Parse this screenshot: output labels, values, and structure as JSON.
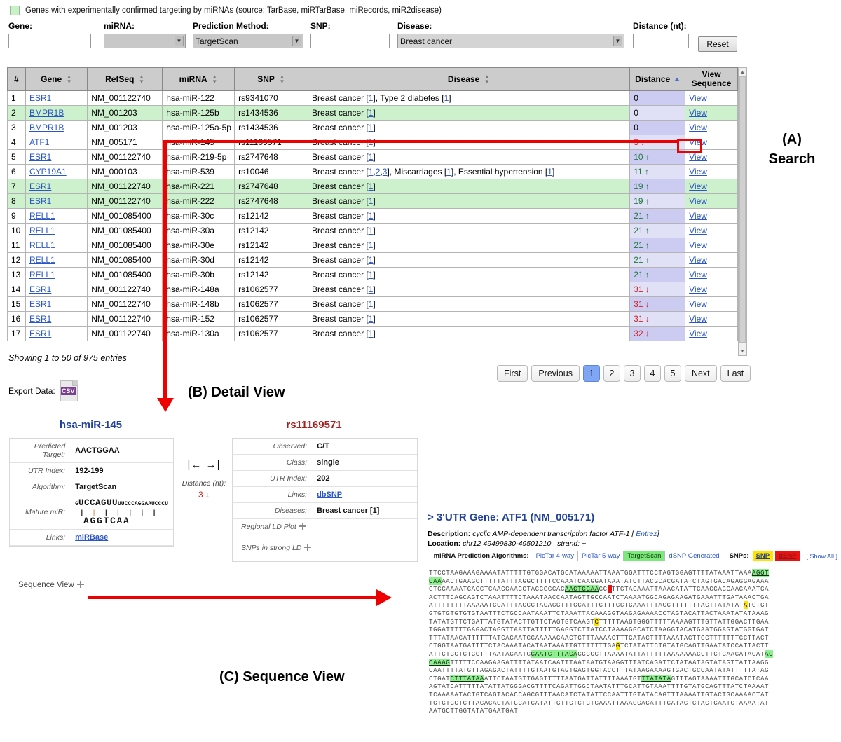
{
  "legend": {
    "text": "Genes with experimentally confirmed targeting by miRNAs (source: TarBase, miRTarBase, miRecords, miR2disease)"
  },
  "search": {
    "gene": {
      "label": "Gene:",
      "value": ""
    },
    "mirna": {
      "label": "miRNA:",
      "value": ""
    },
    "prediction_method": {
      "label": "Prediction Method:",
      "value": "TargetScan"
    },
    "snp": {
      "label": "SNP:",
      "value": ""
    },
    "disease": {
      "label": "Disease:",
      "value": "Breast cancer"
    },
    "distance": {
      "label": "Distance (nt):",
      "value": ""
    },
    "reset_label": "Reset"
  },
  "table": {
    "headers": [
      "#",
      "Gene",
      "RefSeq",
      "miRNA",
      "SNP",
      "Disease",
      "Distance",
      "View Sequence"
    ],
    "view_label": "View",
    "rows": [
      {
        "n": "1",
        "gene": "ESR1",
        "refseq": "NM_001122740",
        "mirna": "hsa-miR-122",
        "snp": "rs9341070",
        "disease": "Breast cancer [1], Type 2 diabetes [1]",
        "distance": "0",
        "dir": "",
        "green": false
      },
      {
        "n": "2",
        "gene": "BMPR1B",
        "refseq": "NM_001203",
        "mirna": "hsa-miR-125b",
        "snp": "rs1434536",
        "disease": "Breast cancer [1]",
        "distance": "0",
        "dir": "",
        "green": true
      },
      {
        "n": "3",
        "gene": "BMPR1B",
        "refseq": "NM_001203",
        "mirna": "hsa-miR-125a-5p",
        "snp": "rs1434536",
        "disease": "Breast cancer [1]",
        "distance": "0",
        "dir": "",
        "green": false
      },
      {
        "n": "4",
        "gene": "ATF1",
        "refseq": "NM_005171",
        "mirna": "hsa-miR-145",
        "snp": "rs11169571",
        "disease": "Breast cancer [1]",
        "distance": "3",
        "dir": "down",
        "green": false
      },
      {
        "n": "5",
        "gene": "ESR1",
        "refseq": "NM_001122740",
        "mirna": "hsa-miR-219-5p",
        "snp": "rs2747648",
        "disease": "Breast cancer [1]",
        "distance": "10",
        "dir": "up",
        "green": false
      },
      {
        "n": "6",
        "gene": "CYP19A1",
        "refseq": "NM_000103",
        "mirna": "hsa-miR-539",
        "snp": "rs10046",
        "disease": "Breast cancer [1,2,3], Miscarriages [1], Essential hypertension [1]",
        "distance": "11",
        "dir": "up",
        "green": false
      },
      {
        "n": "7",
        "gene": "ESR1",
        "refseq": "NM_001122740",
        "mirna": "hsa-miR-221",
        "snp": "rs2747648",
        "disease": "Breast cancer [1]",
        "distance": "19",
        "dir": "up",
        "green": true
      },
      {
        "n": "8",
        "gene": "ESR1",
        "refseq": "NM_001122740",
        "mirna": "hsa-miR-222",
        "snp": "rs2747648",
        "disease": "Breast cancer [1]",
        "distance": "19",
        "dir": "up",
        "green": true
      },
      {
        "n": "9",
        "gene": "RELL1",
        "refseq": "NM_001085400",
        "mirna": "hsa-miR-30c",
        "snp": "rs12142",
        "disease": "Breast cancer [1]",
        "distance": "21",
        "dir": "up",
        "green": false
      },
      {
        "n": "10",
        "gene": "RELL1",
        "refseq": "NM_001085400",
        "mirna": "hsa-miR-30a",
        "snp": "rs12142",
        "disease": "Breast cancer [1]",
        "distance": "21",
        "dir": "up",
        "green": false
      },
      {
        "n": "11",
        "gene": "RELL1",
        "refseq": "NM_001085400",
        "mirna": "hsa-miR-30e",
        "snp": "rs12142",
        "disease": "Breast cancer [1]",
        "distance": "21",
        "dir": "up",
        "green": false
      },
      {
        "n": "12",
        "gene": "RELL1",
        "refseq": "NM_001085400",
        "mirna": "hsa-miR-30d",
        "snp": "rs12142",
        "disease": "Breast cancer [1]",
        "distance": "21",
        "dir": "up",
        "green": false
      },
      {
        "n": "13",
        "gene": "RELL1",
        "refseq": "NM_001085400",
        "mirna": "hsa-miR-30b",
        "snp": "rs12142",
        "disease": "Breast cancer [1]",
        "distance": "21",
        "dir": "up",
        "green": false
      },
      {
        "n": "14",
        "gene": "ESR1",
        "refseq": "NM_001122740",
        "mirna": "hsa-miR-148a",
        "snp": "rs1062577",
        "disease": "Breast cancer [1]",
        "distance": "31",
        "dir": "down",
        "green": false
      },
      {
        "n": "15",
        "gene": "ESR1",
        "refseq": "NM_001122740",
        "mirna": "hsa-miR-148b",
        "snp": "rs1062577",
        "disease": "Breast cancer [1]",
        "distance": "31",
        "dir": "down",
        "green": false
      },
      {
        "n": "16",
        "gene": "ESR1",
        "refseq": "NM_001122740",
        "mirna": "hsa-miR-152",
        "snp": "rs1062577",
        "disease": "Breast cancer [1]",
        "distance": "31",
        "dir": "down",
        "green": false
      },
      {
        "n": "17",
        "gene": "ESR1",
        "refseq": "NM_001122740",
        "mirna": "hsa-miR-130a",
        "snp": "rs1062577",
        "disease": "Breast cancer [1]",
        "distance": "32",
        "dir": "down",
        "green": false
      }
    ]
  },
  "footer": {
    "showing": "Showing 1 to 50 of 975 entries",
    "export_label": "Export Data:",
    "csv_label": "CSV"
  },
  "pagination": {
    "first": "First",
    "previous": "Previous",
    "next": "Next",
    "last": "Last",
    "pages": [
      "1",
      "2",
      "3",
      "4",
      "5"
    ],
    "active": "1"
  },
  "detail": {
    "mirna": {
      "title": "hsa-miR-145",
      "rows": [
        {
          "k": "Predicted Target:",
          "v": "AACTGGAA"
        },
        {
          "k": "UTR Index:",
          "v": "192-199"
        },
        {
          "k": "Algorithm:",
          "v": "TargetScan"
        }
      ],
      "mature_label": "Mature miR:",
      "mature_prefix": "G",
      "mature_core": "UCCAGUU",
      "mature_suffix": "UUCCCAGGAAUCCCU",
      "mature_match": "AGGTCAA",
      "links_label": "Links:",
      "links_value": "miRBase"
    },
    "distance": {
      "ruler": "|←  →|",
      "label": "Distance (nt):",
      "value": "3 ↓"
    },
    "snp": {
      "title": "rs11169571",
      "rows": [
        {
          "k": "Observed:",
          "v": "C/T"
        },
        {
          "k": "Class:",
          "v": "single"
        },
        {
          "k": "UTR Index:",
          "v": "202"
        },
        {
          "k": "Links:",
          "v": "dbSNP"
        },
        {
          "k": "Diseases:",
          "v": "Breast cancer [1]"
        }
      ],
      "regional_ld_label": "Regional LD Plot",
      "snps_strong_ld_label": "SNPs in strong LD"
    },
    "sequence_view_label": "Sequence View"
  },
  "utr": {
    "heading": "> 3'UTR Gene: ATF1 (NM_005171)",
    "description_label": "Description:",
    "description_value": "cyclic AMP-dependent transcription factor ATF-1 [",
    "entrez_label": "Entrez",
    "description_close": "]",
    "location_label": "Location:",
    "location_value": "chr12 49499830-49501210",
    "strand_label": "strand:",
    "strand_value": "+",
    "algorithms_label": "miRNA Prediction Algorithms:",
    "algorithms": [
      {
        "name": "PicTar 4-way",
        "active": false
      },
      {
        "name": "PicTar 5-way",
        "active": false
      },
      {
        "name": "TargetScan",
        "active": true
      },
      {
        "name": "dSNP Generated",
        "active": false
      }
    ],
    "snps_label": "SNPs:",
    "snp_chip": "SNP",
    "dsnp_chip": "dSNP",
    "show_all": "[ Show All ]"
  },
  "sequence": {
    "lines": [
      [
        {
          "t": "TTCCTAAGAAAGAAAATATTTTTGTGGACATGCATAAAAATTAAATGGATTTCCTAGTGGAGTTTTATAAATTAAA"
        },
        {
          "t": "AGGT",
          "s": "hl"
        }
      ],
      [
        {
          "t": "CAA",
          "s": "hl"
        },
        {
          "t": "AACTGAAGCTTTTTATTTAGGCTTTTCCAAATCAAGGATAAATATCTTACGCACGATATCTAGTGACAGAGGAGAAA"
        }
      ],
      [
        {
          "t": "GTGGAAAATGACCTCAAGGAAGCTACGGGCAC"
        },
        {
          "t": "AACTGGAA",
          "s": "hl"
        },
        {
          "t": "GC"
        },
        {
          "t": "T",
          "s": "r"
        },
        {
          "t": "TTGTAGAAATTAAACATATTCAAGGAGCAAGAAATGA"
        }
      ],
      [
        {
          "t": "ACTTTCAGCAGTCTAAATTTTCTAAATAACCAATAGTTGCCAATCTAAAATGGCAGAGAAGATGAAATTTGATAAACTGA"
        }
      ],
      [
        {
          "t": "ATTTTTTTTAAAAATCCATTTACCCTACAGGTTTGCATTTGTTTGCTGAAATTTACCTTTTTTTAGTTATATAT"
        },
        {
          "t": "A",
          "s": "y"
        },
        {
          "t": "TGTGT"
        }
      ],
      [
        {
          "t": "GTGTGTGTGTGTAATTTCTGCCAATAAATTCTAAATTACAAAGGTAAGAGAAAACCTAGTACATTACTAAATATATAAAG"
        }
      ],
      [
        {
          "t": "TATATGTTCTGATTATGTATACTTGTTCTAGTGTCAAGT"
        },
        {
          "t": "C",
          "s": "y"
        },
        {
          "t": "TTTTTAAGTGGGTTTTTAAAAGTTTGTTATTGGACTTGAA"
        }
      ],
      [
        {
          "t": "TGGATTTTTGAGACTAGGTTAATTATTTTTGAGGTCTTATCCTAAAAGGCATCTAAGGTACATGAATGGAGTATGGTGAT"
        }
      ],
      [
        {
          "t": "TTTATAACATTTTTTATCAGAATGGAAAAAGAACTGTTTAAAAGTTTGATACTTTTAAATAGTTGGTTTTTTTGCTTACT"
        }
      ],
      [
        {
          "t": "CTGGTAATGATTTTCTACAAATACATAATAAATTGTTTTTTTGA"
        },
        {
          "t": "G",
          "s": "y"
        },
        {
          "t": "TCTATATTCTGTATGCAGTTGAATATCCATTACTT"
        }
      ],
      [
        {
          "t": "ATTCTGCTGTGCTTTAATAGAATG"
        },
        {
          "t": "GAATGTTTACA",
          "s": "hl"
        },
        {
          "t": "GGCCCTTAAAATATTATTTTTAAAAAAACCTTCTGAAGATACAT"
        },
        {
          "t": "AC",
          "s": "hl"
        }
      ],
      [
        {
          "t": "CAAAG",
          "s": "hl"
        },
        {
          "t": "TTTTTCCAAGAAGATTTTATAATCAATTTAATAATGTAAGGTTTATCAGATTCTATAATAGTATAGTTATTAAGG"
        }
      ],
      [
        {
          "t": "CAATTTTATGTTAGAGACTATTTTGTAATGTAGTGAGTGGTACCTTTATAAGAAAAGTGACTGCCAATATATTTTTATAG"
        }
      ],
      [
        {
          "t": "CTGAT"
        },
        {
          "t": "CTTTATAA",
          "s": "hl"
        },
        {
          "t": "ATTCTAATGTTGAGTTTTTAATGATTATTTTAAATGT"
        },
        {
          "t": "TTATATA",
          "s": "hl"
        },
        {
          "t": "GTTTAGTAAAATTTGCATCTCAA"
        }
      ],
      [
        {
          "t": "AGTATCATTTTTATATTATGGGACGTTTTCAGATTGGCTAATATTTGCATTGTAAATTTTGTATGCAGTTTATCTAAAAT"
        }
      ],
      [
        {
          "t": "TCAAAAATACTGTCAGTACACCAGCGTTTAACATCTATATTCCAATTTGTATACAGTTTAAAATTGTACTGCAAAACTAT"
        }
      ],
      [
        {
          "t": "TGTGTGCTCTTACACAGTATGCATCATATTGTTGTCTGTGAAATTAAAGGACATTTGATAGTCTACTGAATGTAAAATAT"
        }
      ],
      [
        {
          "t": "AATGCTTGGTATATGAATGAT"
        }
      ]
    ]
  },
  "annotations": {
    "a": "(A)\nSearch",
    "a_line1": "(A)",
    "a_line2": "Search",
    "b": "(B) Detail View",
    "c": "(C) Sequence View"
  }
}
